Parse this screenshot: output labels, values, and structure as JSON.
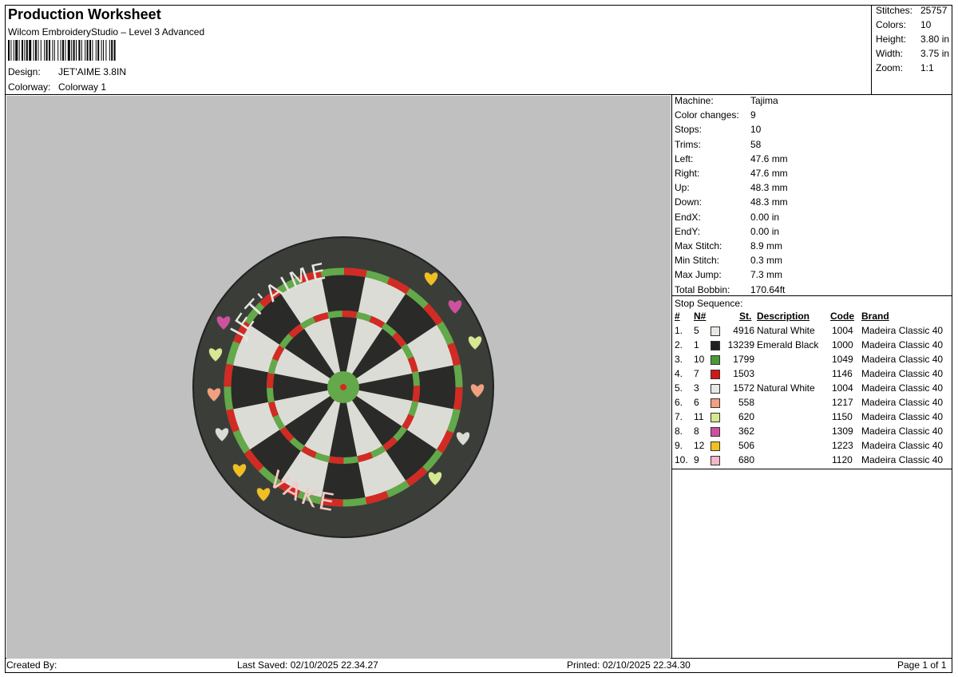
{
  "header": {
    "title": "Production Worksheet",
    "software": "Wilcom EmbroideryStudio – Level 3 Advanced",
    "design_label": "Design:",
    "design_value": "JET'AIME 3.8IN",
    "colorway_label": "Colorway:",
    "colorway_value": "Colorway 1"
  },
  "summary": [
    {
      "label": "Stitches:",
      "value": "25757"
    },
    {
      "label": "Colors:",
      "value": "10"
    },
    {
      "label": "Height:",
      "value": "3.80 in"
    },
    {
      "label": "Width:",
      "value": "3.75 in"
    },
    {
      "label": "Zoom:",
      "value": "1:1"
    }
  ],
  "machine_info": [
    {
      "label": "Machine:",
      "value": "Tajima"
    },
    {
      "label": "Color changes:",
      "value": "9"
    },
    {
      "label": "Stops:",
      "value": "10"
    },
    {
      "label": "Trims:",
      "value": "58"
    },
    {
      "label": "Left:",
      "value": "47.6 mm"
    },
    {
      "label": "Right:",
      "value": "47.6 mm"
    },
    {
      "label": "Up:",
      "value": "48.3 mm"
    },
    {
      "label": "Down:",
      "value": "48.3 mm"
    },
    {
      "label": "EndX:",
      "value": "0.00 in"
    },
    {
      "label": "EndY:",
      "value": "0.00 in"
    },
    {
      "label": "Max Stitch:",
      "value": "8.9 mm"
    },
    {
      "label": "Min Stitch:",
      "value": "0.3 mm"
    },
    {
      "label": "Max Jump:",
      "value": "7.3 mm"
    },
    {
      "label": "Total Bobbin:",
      "value": "170.64ft"
    }
  ],
  "stop_sequence": {
    "title": "Stop Sequence:",
    "headers": {
      "idx": "#",
      "n": "N#",
      "st": "St.",
      "desc": "Description",
      "code": "Code",
      "brand": "Brand"
    },
    "rows": [
      {
        "idx": "1.",
        "n": "5",
        "color": "#e8e8e4",
        "st": "4916",
        "desc": "Natural White",
        "code": "1004",
        "brand": "Madeira Classic 40"
      },
      {
        "idx": "2.",
        "n": "1",
        "color": "#202020",
        "st": "13239",
        "desc": "Emerald Black",
        "code": "1000",
        "brand": "Madeira Classic 40"
      },
      {
        "idx": "3.",
        "n": "10",
        "color": "#4a9a3a",
        "st": "1799",
        "desc": "",
        "code": "1049",
        "brand": "Madeira Classic 40"
      },
      {
        "idx": "4.",
        "n": "7",
        "color": "#d01818",
        "st": "1503",
        "desc": "",
        "code": "1146",
        "brand": "Madeira Classic 40"
      },
      {
        "idx": "5.",
        "n": "3",
        "color": "#e8e8e4",
        "st": "1572",
        "desc": "Natural White",
        "code": "1004",
        "brand": "Madeira Classic 40"
      },
      {
        "idx": "6.",
        "n": "6",
        "color": "#f2a080",
        "st": "558",
        "desc": "",
        "code": "1217",
        "brand": "Madeira Classic 40"
      },
      {
        "idx": "7.",
        "n": "11",
        "color": "#d6e890",
        "st": "620",
        "desc": "",
        "code": "1150",
        "brand": "Madeira Classic 40"
      },
      {
        "idx": "8.",
        "n": "8",
        "color": "#d050a0",
        "st": "362",
        "desc": "",
        "code": "1309",
        "brand": "Madeira Classic 40"
      },
      {
        "idx": "9.",
        "n": "12",
        "color": "#f0c020",
        "st": "506",
        "desc": "",
        "code": "1223",
        "brand": "Madeira Classic 40"
      },
      {
        "idx": "10.",
        "n": "9",
        "color": "#f4b8c8",
        "st": "680",
        "desc": "",
        "code": "1120",
        "brand": "Madeira Classic 40"
      }
    ]
  },
  "preview": {
    "background": "#c0c0c0",
    "patch_top_text": "JET'AIME",
    "patch_bottom_text": "VAKE",
    "colors": {
      "border": "#3a3d38",
      "white": "#dcdcd6",
      "black": "#2a2a28",
      "green": "#63a84a",
      "red": "#d22a24"
    }
  },
  "footer": {
    "created_by": "Created By:",
    "last_saved": "Last Saved: 02/10/2025 22.34.27",
    "printed": "Printed: 02/10/2025 22.34.30",
    "page": "Page 1 of 1"
  }
}
